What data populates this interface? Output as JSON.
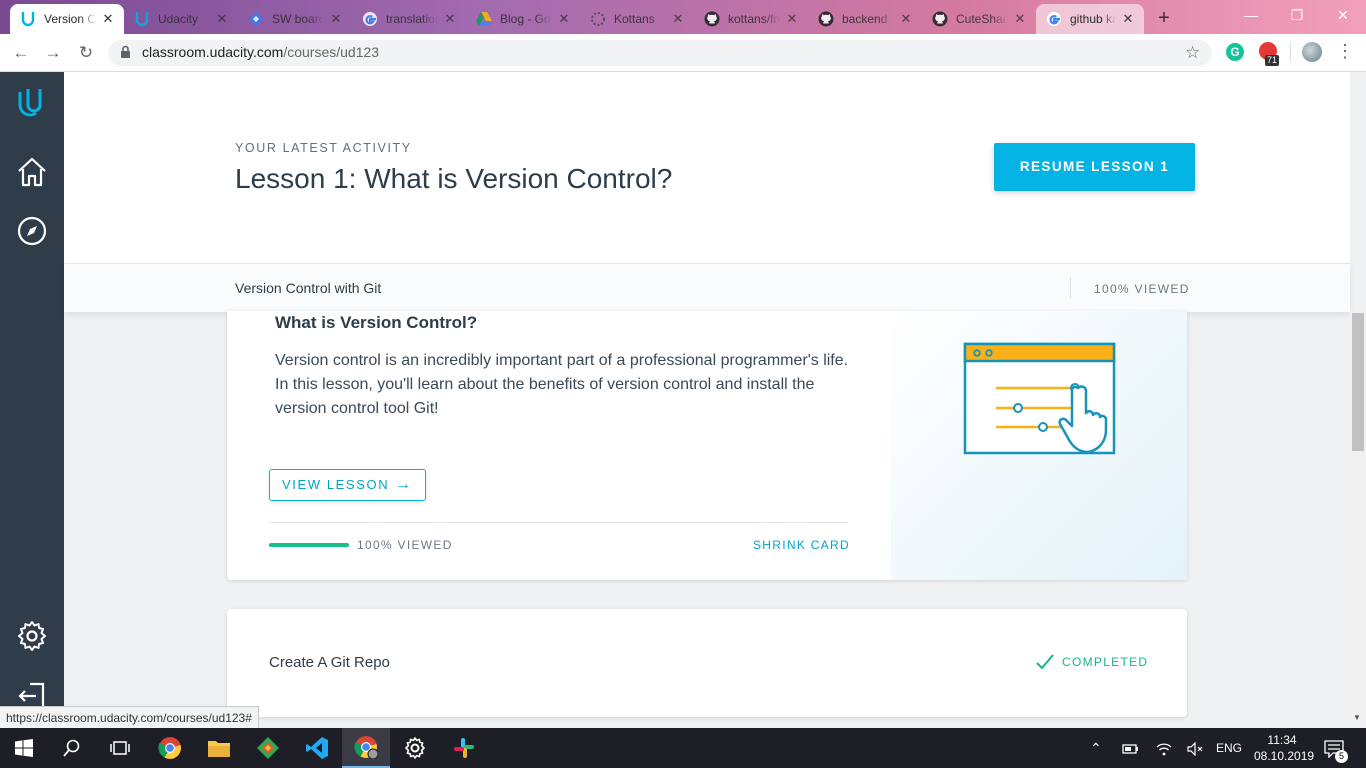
{
  "browser": {
    "tabs": [
      {
        "label": "Version Control with Git",
        "icon": "udacity-icon",
        "active": true
      },
      {
        "label": "Udacity",
        "icon": "udacity-icon"
      },
      {
        "label": "SW board",
        "icon": "jira-icon"
      },
      {
        "label": "translation",
        "icon": "google-icon"
      },
      {
        "label": "Blog - Google Drive",
        "icon": "drive-icon"
      },
      {
        "label": "Kottans",
        "icon": "kottans-icon"
      },
      {
        "label": "kottans/frontend",
        "icon": "github-icon"
      },
      {
        "label": "backend",
        "icon": "github-icon"
      },
      {
        "label": "CuteShadow",
        "icon": "github-icon"
      },
      {
        "label": "github ka",
        "icon": "google-icon"
      }
    ],
    "url_host": "classroom.udacity.com",
    "url_path": "/courses/ud123",
    "extension_badge": "71",
    "status_url": "https://classroom.udacity.com/courses/ud123#"
  },
  "activity": {
    "eyebrow": "YOUR LATEST ACTIVITY",
    "title": "Lesson 1: What is Version Control?",
    "resume_label": "RESUME LESSON 1"
  },
  "course_bar": {
    "course_name": "Version Control with Git",
    "viewed": "100% VIEWED"
  },
  "lesson_card": {
    "title": "What is Version Control?",
    "description": "Version control is an incredibly important part of a professional programmer's life. In this lesson, you'll learn about the benefits of version control and install the version control tool Git!",
    "view_label": "VIEW LESSON",
    "progress": 1.0,
    "viewed": "100% VIEWED",
    "shrink_label": "SHRINK CARD"
  },
  "next_card": {
    "title": "Create A Git Repo",
    "status": "COMPLETED"
  },
  "taskbar": {
    "language": "ENG",
    "time": "11:34",
    "date": "08.10.2019",
    "notifications": "5"
  },
  "colors": {
    "accent": "#02b3e4",
    "sidebar": "#2e3d49",
    "progress": "#16c08b"
  }
}
